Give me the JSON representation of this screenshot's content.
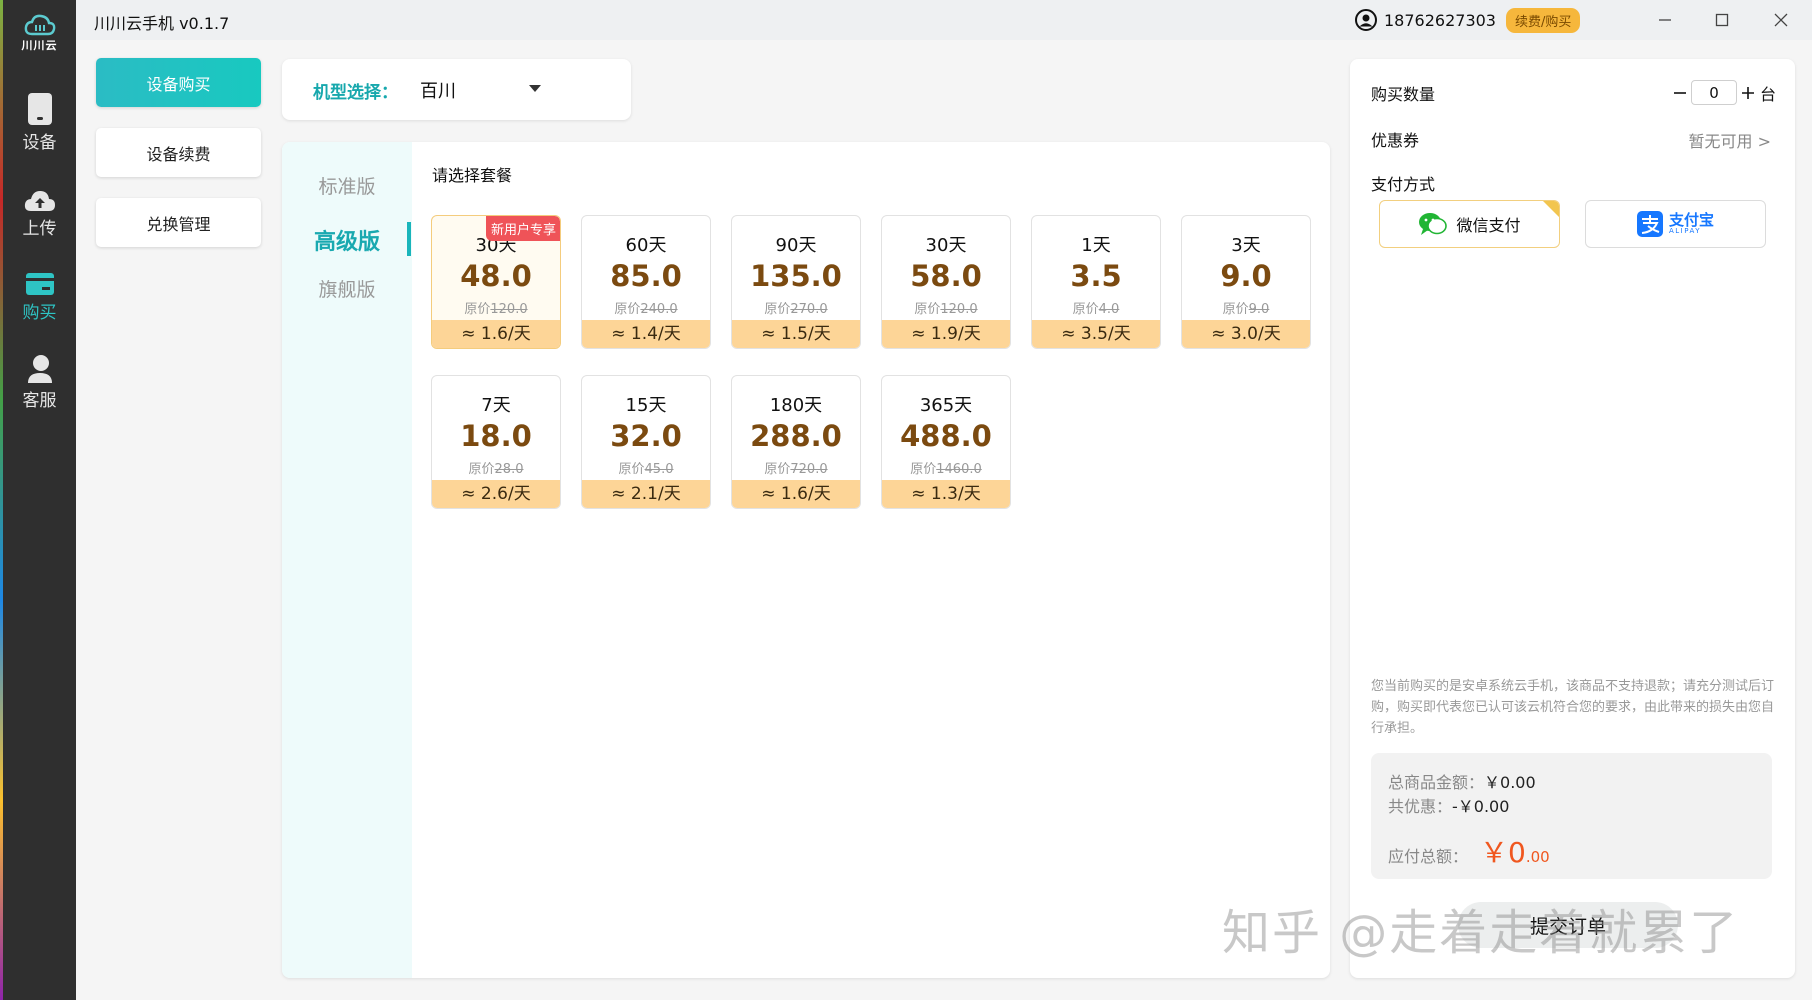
{
  "window": {
    "title": "川川云手机 v0.1.7"
  },
  "user": {
    "phone": "18762627303",
    "renew_label": "续费/购买"
  },
  "rail": {
    "logo_text": "川川云",
    "items": [
      {
        "label": "设备",
        "icon": "phone-icon"
      },
      {
        "label": "上传",
        "icon": "cloud-upload-icon"
      },
      {
        "label": "购买",
        "icon": "card-icon"
      },
      {
        "label": "客服",
        "icon": "service-icon"
      }
    ],
    "active_index": 2
  },
  "left_nav": [
    "设备购买",
    "设备续费",
    "兑换管理"
  ],
  "model": {
    "label": "机型选择：",
    "value": "百川"
  },
  "tiers": {
    "items": [
      "标准版",
      "高级版",
      "旗舰版"
    ],
    "active": "高级版"
  },
  "plans": {
    "heading": "请选择套餐",
    "cards": [
      {
        "days": "30天",
        "price": "48.0",
        "orig_label": "原价",
        "orig": "120.0",
        "daily": "≈ 1.6/天",
        "tag": "新用户专享",
        "selected": true
      },
      {
        "days": "60天",
        "price": "85.0",
        "orig_label": "原价",
        "orig": "240.0",
        "daily": "≈ 1.4/天"
      },
      {
        "days": "90天",
        "price": "135.0",
        "orig_label": "原价",
        "orig": "270.0",
        "daily": "≈ 1.5/天"
      },
      {
        "days": "30天",
        "price": "58.0",
        "orig_label": "原价",
        "orig": "120.0",
        "daily": "≈ 1.9/天"
      },
      {
        "days": "1天",
        "price": "3.5",
        "orig_label": "原价",
        "orig": "4.0",
        "daily": "≈ 3.5/天"
      },
      {
        "days": "3天",
        "price": "9.0",
        "orig_label": "原价",
        "orig": "9.0",
        "daily": "≈ 3.0/天"
      },
      {
        "days": "7天",
        "price": "18.0",
        "orig_label": "原价",
        "orig": "28.0",
        "daily": "≈ 2.6/天"
      },
      {
        "days": "15天",
        "price": "32.0",
        "orig_label": "原价",
        "orig": "45.0",
        "daily": "≈ 2.1/天"
      },
      {
        "days": "180天",
        "price": "288.0",
        "orig_label": "原价",
        "orig": "720.0",
        "daily": "≈ 1.6/天"
      },
      {
        "days": "365天",
        "price": "488.0",
        "orig_label": "原价",
        "orig": "1460.0",
        "daily": "≈ 1.3/天"
      }
    ]
  },
  "order": {
    "qty_label": "购买数量",
    "qty_value": "0",
    "qty_unit": "台",
    "coupon_label": "优惠券",
    "coupon_value": "暂无可用 >",
    "pay_label": "支付方式",
    "pay_methods": {
      "wechat": "微信支付",
      "alipay": "支付宝",
      "alipay_en": "ALIPAY"
    },
    "pay_selected": "wechat",
    "notice": "您当前购买的是安卓系统云手机，该商品不支持退款；请充分测试后订购，购买即代表您已认可该云机符合您的要求，由此带来的损失由您自行承担。",
    "total_label": "总商品金额：",
    "total_value": "￥0.00",
    "discount_label": "共优惠：",
    "discount_value": "-￥0.00",
    "pay_total_label": "应付总额：",
    "pay_total_currency": "￥",
    "pay_total_int": "0",
    "pay_total_dec": ".00",
    "submit_label": "提交订单"
  },
  "watermark": "知乎 @走着走着就累了",
  "colors": {
    "accent": "#19b5bb",
    "price": "#7b4a10",
    "daily_bg": "#fdd597",
    "tag": "#ef5358",
    "total": "#f0571f",
    "rail": "#2f2f2f"
  }
}
